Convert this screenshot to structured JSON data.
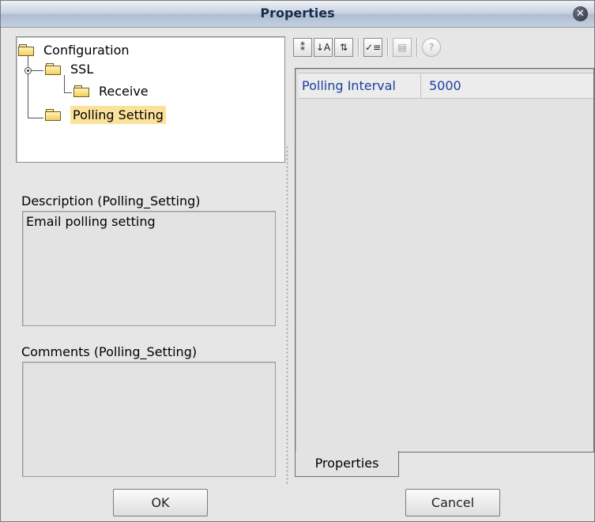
{
  "window": {
    "title": "Properties"
  },
  "tree": {
    "items": [
      {
        "label": "Configuration"
      },
      {
        "label": "SSL"
      },
      {
        "label": "Receive"
      },
      {
        "label": "Polling Setting"
      }
    ]
  },
  "description": {
    "label": "Description (Polling_Setting)",
    "text": "Email polling setting"
  },
  "comments": {
    "label": "Comments (Polling_Setting)",
    "text": ""
  },
  "toolbar": {
    "buttons": [
      {
        "icon": "sort-by-category-icon",
        "glyph": "⁑"
      },
      {
        "icon": "sort-alphabetically-icon",
        "glyph": "↓A"
      },
      {
        "icon": "show-changed-properties-icon",
        "glyph": "⇅"
      },
      {
        "icon": "toggle-description-icon",
        "glyph": "✓≡"
      },
      {
        "icon": "property-sheet-icon",
        "glyph": "▤"
      },
      {
        "icon": "help-icon",
        "glyph": "?"
      }
    ]
  },
  "properties": {
    "rows": [
      {
        "name": "Polling Interval",
        "value": "5000"
      }
    ],
    "tab_label": "Properties"
  },
  "buttons": {
    "ok": "OK",
    "cancel": "Cancel"
  },
  "colors": {
    "selection": "#fbe29a",
    "property_text": "#1b3fa0"
  }
}
